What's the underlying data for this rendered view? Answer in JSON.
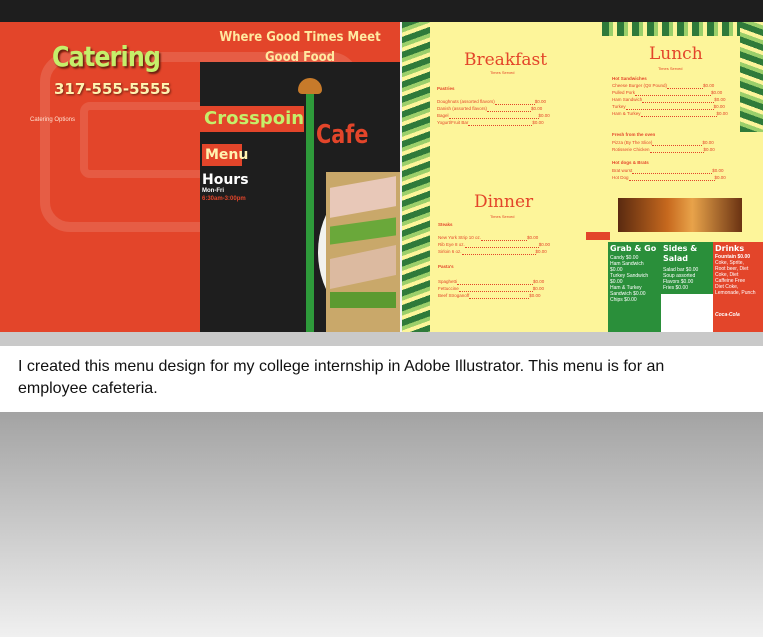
{
  "cover": {
    "catering_title": "Catering",
    "phone": "317-555-5555",
    "catering_options": "Catering Options",
    "tagline": "Where Good Times Meet Good Food",
    "brand_word1": "Crosspoint",
    "brand_word2": "Cafe",
    "menu_label": "Menu",
    "hours_label": "Hours",
    "hours_days": "Mon-Fri",
    "hours_time": "6:30am-3:00pm"
  },
  "inside": {
    "breakfast": {
      "title": "Breakfast",
      "subtitle": "Times Served",
      "category": "Pastries",
      "items": [
        {
          "name": "Doughnuts (assorted flavors)",
          "price": "$0.00"
        },
        {
          "name": "Danish (assorted flavors)",
          "price": "$0.00"
        },
        {
          "name": "Bagel",
          "price": "$0.00"
        },
        {
          "name": "Yogurt/Fruit Bar",
          "price": "$0.00"
        }
      ]
    },
    "lunch": {
      "title": "Lunch",
      "subtitle": "Times Served",
      "categories": [
        {
          "name": "Hot Sandwiches",
          "items": [
            {
              "name": "Cheese Burger (Qtr Pound)",
              "price": "$0.00"
            },
            {
              "name": "Pulled Pork",
              "price": "$0.00"
            },
            {
              "name": "Ham Sandwich",
              "price": "$0.00"
            },
            {
              "name": "Turkey",
              "price": "$0.00"
            },
            {
              "name": "Ham & Turkey",
              "price": "$0.00"
            }
          ]
        },
        {
          "name": "Fresh from the oven",
          "items": [
            {
              "name": "Pizza (By The Slice)",
              "price": "$0.00"
            },
            {
              "name": "Rotisserie Chicken",
              "price": "$0.00"
            }
          ]
        },
        {
          "name": "Hot dogs & Brats",
          "items": [
            {
              "name": "Brat wurst",
              "price": "$0.00"
            },
            {
              "name": "Hot Dog",
              "price": "$0.00"
            }
          ]
        }
      ]
    },
    "dinner": {
      "title": "Dinner",
      "subtitle": "Times Served",
      "categories": [
        {
          "name": "Steaks",
          "items": [
            {
              "name": "New York Strip 10 oz.",
              "price": "$0.00"
            },
            {
              "name": "Rib Eye 8 oz.",
              "price": "$0.00"
            },
            {
              "name": "Sirloin 6 oz.",
              "price": "$0.00"
            }
          ]
        },
        {
          "name": "Pasta's",
          "items": [
            {
              "name": "Spaghetti",
              "price": "$0.00"
            },
            {
              "name": "Fettuccine",
              "price": "$0.00"
            },
            {
              "name": "Beef Stroganoff",
              "price": "$0.00"
            }
          ]
        }
      ]
    },
    "grab_go": {
      "title": "Grab & Go",
      "lines": [
        "Candy $0.00",
        "Ham Sandwich",
        "$0.00",
        "Turkey Sandwich",
        "$0.00",
        "Ham & Turkey",
        "Sandwich $0.00",
        "Chips $0.00"
      ]
    },
    "sides": {
      "title": "Sides & Salad",
      "lines": [
        "Salad bar $0.00",
        "Soup assorted",
        "Flavors $0.00",
        "Fries $0.00"
      ]
    },
    "drinks": {
      "title": "Drinks",
      "lines": [
        "Fountain $0.00",
        "Coke, Sprite,",
        "Root beer, Diet",
        "Coke, Diet",
        "Caffeine Free",
        "Diet Coke,",
        "Lemonade, Punch"
      ],
      "logo": "Coca-Cola"
    }
  },
  "caption": "I created this menu design for my college internship in Adobe Illustrator.  This menu is for an employee cafeteria.",
  "colors": {
    "red": "#e3452a",
    "green": "#2a8f3a",
    "yellow": "#fdf59a",
    "black": "#1e1e1e"
  }
}
